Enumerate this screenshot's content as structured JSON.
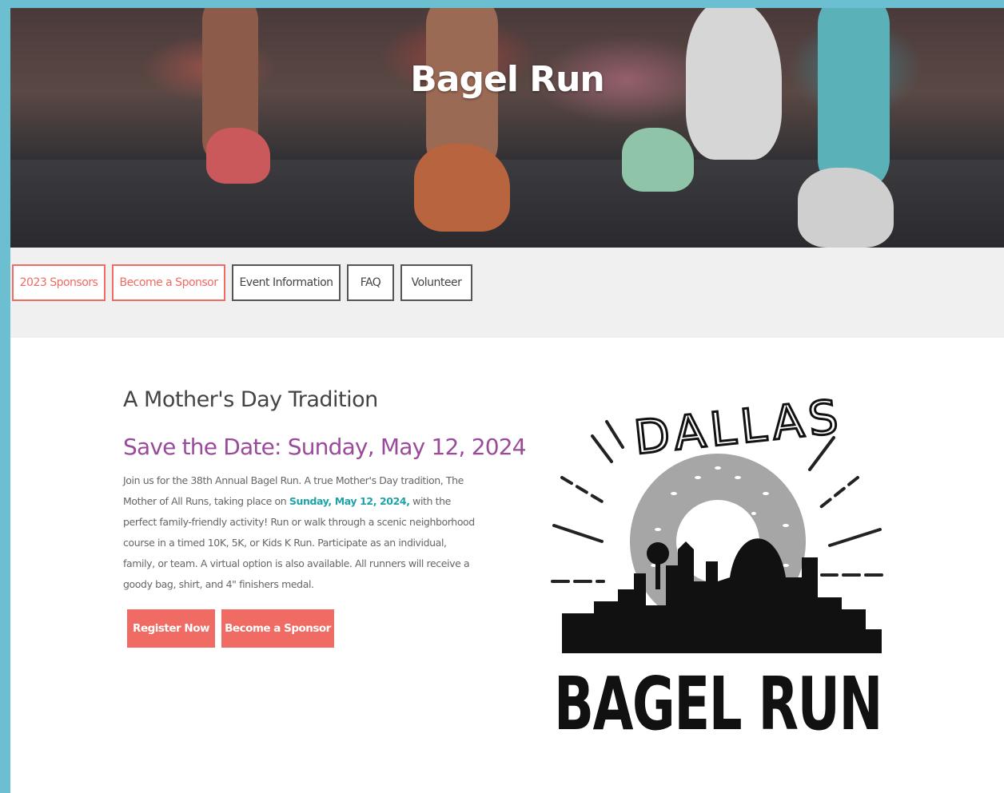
{
  "hero": {
    "title": "Bagel Run"
  },
  "nav": {
    "tabs": [
      "2023 Sponsors",
      "Become a Sponsor",
      "Event Information",
      "FAQ",
      "Volunteer"
    ]
  },
  "main": {
    "heading": "A Mother's Day Tradition",
    "subheading": "Save the Date: Sunday, May 12, 2024",
    "para_1": "Join us for the 38th Annual Bagel Run. A true Mother's Day tradition, The Mother of All Runs, taking place on ",
    "para_date": "Sunday, May 12, 2024,",
    "para_2": " with the perfect family-friendly activity! Run or walk through a scenic neighborhood course in a timed 10K, 5K, or Kids K Run. Participate as an individual, family, or team. A virtual option is also available. All runners will receive a goody bag, shirt, and 4\" finishers medal.",
    "register_label": "Register Now",
    "sponsor_label": "Become a Sponsor"
  },
  "logo": {
    "top_text": "DALLAS",
    "bottom_text": "BAGEL RUN"
  },
  "colors": {
    "accent": "#ef6b63",
    "purple": "#9a4a9b",
    "teal": "#1fa2a8",
    "frame": "#6bbfd0"
  }
}
